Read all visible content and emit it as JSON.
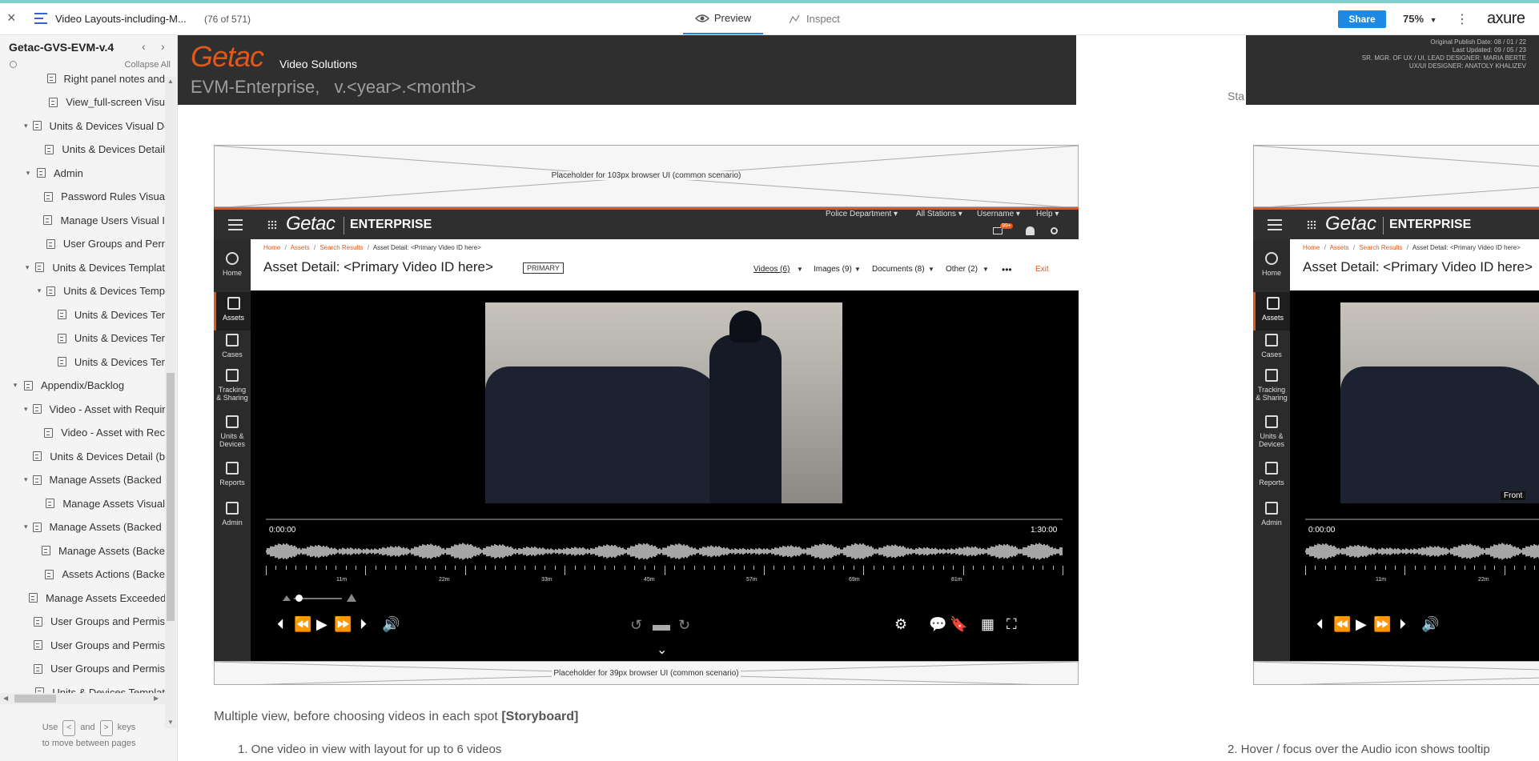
{
  "topbar": {
    "close_glyph": "×",
    "doc_title": "Video Layouts-including-M...",
    "page_counter": "(76 of 571)",
    "tab_preview": "Preview",
    "tab_inspect": "Inspect",
    "share_label": "Share",
    "zoom": "75%",
    "brand": "axure",
    "more_glyph": "⋮",
    "accent_color": "#1e88e5"
  },
  "sidebar": {
    "project": "Getac-GVS-EVM-v.4",
    "collapse_all": "Collapse All",
    "items": [
      {
        "label": "Right panel notes and",
        "indent": 2,
        "caret": ""
      },
      {
        "label": "View_full-screen Visu",
        "indent": 2,
        "caret": ""
      },
      {
        "label": "Units & Devices Visual De",
        "indent": 1,
        "caret": "▾"
      },
      {
        "label": "Units & Devices Detail",
        "indent": 2,
        "caret": ""
      },
      {
        "label": "Admin",
        "indent": 1,
        "caret": "▾"
      },
      {
        "label": "Password Rules Visua",
        "indent": 2,
        "caret": ""
      },
      {
        "label": "Manage Users Visual I",
        "indent": 2,
        "caret": ""
      },
      {
        "label": "User Groups and Perr",
        "indent": 2,
        "caret": ""
      },
      {
        "label": "Units & Devices Templat",
        "indent": 1,
        "caret": "▾"
      },
      {
        "label": "Units & Devices Temp",
        "indent": 2,
        "caret": "▾"
      },
      {
        "label": "Units & Devices Ter",
        "indent": 3,
        "caret": ""
      },
      {
        "label": "Units & Devices Ter",
        "indent": 3,
        "caret": ""
      },
      {
        "label": "Units & Devices Ter",
        "indent": 3,
        "caret": ""
      },
      {
        "label": "Appendix/Backlog",
        "indent": 0,
        "caret": "▾"
      },
      {
        "label": "Video - Asset with Requir",
        "indent": 1,
        "caret": "▾"
      },
      {
        "label": "Video - Asset with Rec",
        "indent": 2,
        "caret": ""
      },
      {
        "label": "Units & Devices Detail (b",
        "indent": 1,
        "caret": ""
      },
      {
        "label": "Manage Assets (Backed u",
        "indent": 1,
        "caret": "▾"
      },
      {
        "label": "Manage Assets Visual",
        "indent": 2,
        "caret": ""
      },
      {
        "label": "Manage Assets (Backed u",
        "indent": 1,
        "caret": "▾"
      },
      {
        "label": "Manage Assets (Backe",
        "indent": 2,
        "caret": ""
      },
      {
        "label": "Assets Actions (Backe",
        "indent": 2,
        "caret": ""
      },
      {
        "label": "Manage Assets Exceeded",
        "indent": 1,
        "caret": ""
      },
      {
        "label": "User Groups and Permis",
        "indent": 1,
        "caret": ""
      },
      {
        "label": "User Groups and Permis",
        "indent": 1,
        "caret": ""
      },
      {
        "label": "User Groups and Permis",
        "indent": 1,
        "caret": ""
      },
      {
        "label": "Units & Devices Templat",
        "indent": 1,
        "caret": ""
      }
    ],
    "footer_use": "Use",
    "footer_and": "and",
    "footer_keys": "keys",
    "footer_line2": "to move between pages",
    "key_left": "<",
    "key_right": ">"
  },
  "header_banner": {
    "logo": "Getac",
    "logo_sub": "Video Solutions",
    "product": "EVM-Enterprise,",
    "version": "v.<year>.<month>",
    "logo_color": "#e0591b"
  },
  "info_box": {
    "line1": "Original Publish Date: 08 / 01 / 22",
    "line2": "Last Updated: 09 / 05 / 23",
    "line3": "SR. MGR. OF UX / UI, LEAD DESIGNER: MARIA BERTE",
    "line4": "UX/UI DESIGNER: ANATOLY KHALIZEV",
    "peek": "Sta"
  },
  "mockup": {
    "ph_top": "Placeholder for 103px browser UI (common scenario)",
    "ph_bottom": "Placeholder for 39px browser UI (common scenario)",
    "logo": "Getac",
    "enterprise": "ENTERPRISE",
    "menus": [
      "Police Department ▾",
      "All Stations ▾",
      "Username ▾",
      "Help ▾"
    ],
    "badge": "99+",
    "breadcrumb": [
      "Home",
      "Assets",
      "Search Results",
      "Asset Detail: <Primary Video ID here>"
    ],
    "breadcrumb_sep": "/",
    "title": "Asset Detail: <Primary Video ID here>",
    "primary_tag": "PRIMARY",
    "tabs": [
      "Videos (6)",
      "Images (9)",
      "Documents (8)",
      "Other (2)"
    ],
    "more": "•••",
    "exit": "Exit",
    "nav": [
      "Home",
      "Assets",
      "Cases",
      "Tracking & Sharing",
      "Units & Devices",
      "Reports",
      "Admin"
    ],
    "time_start": "0:00:00",
    "time_end": "1:30:00",
    "ticks": [
      "11m",
      "22m",
      "33m",
      "45m",
      "57m",
      "69m",
      "81m"
    ],
    "front_label": "Front"
  },
  "captions": {
    "section": "Multiple view, before choosing videos in each spot",
    "section_bold": "[Storyboard]",
    "item1": "1. One video in view with layout for up to 6 videos",
    "item2": "2. Hover / focus over the Audio icon shows tooltip"
  }
}
